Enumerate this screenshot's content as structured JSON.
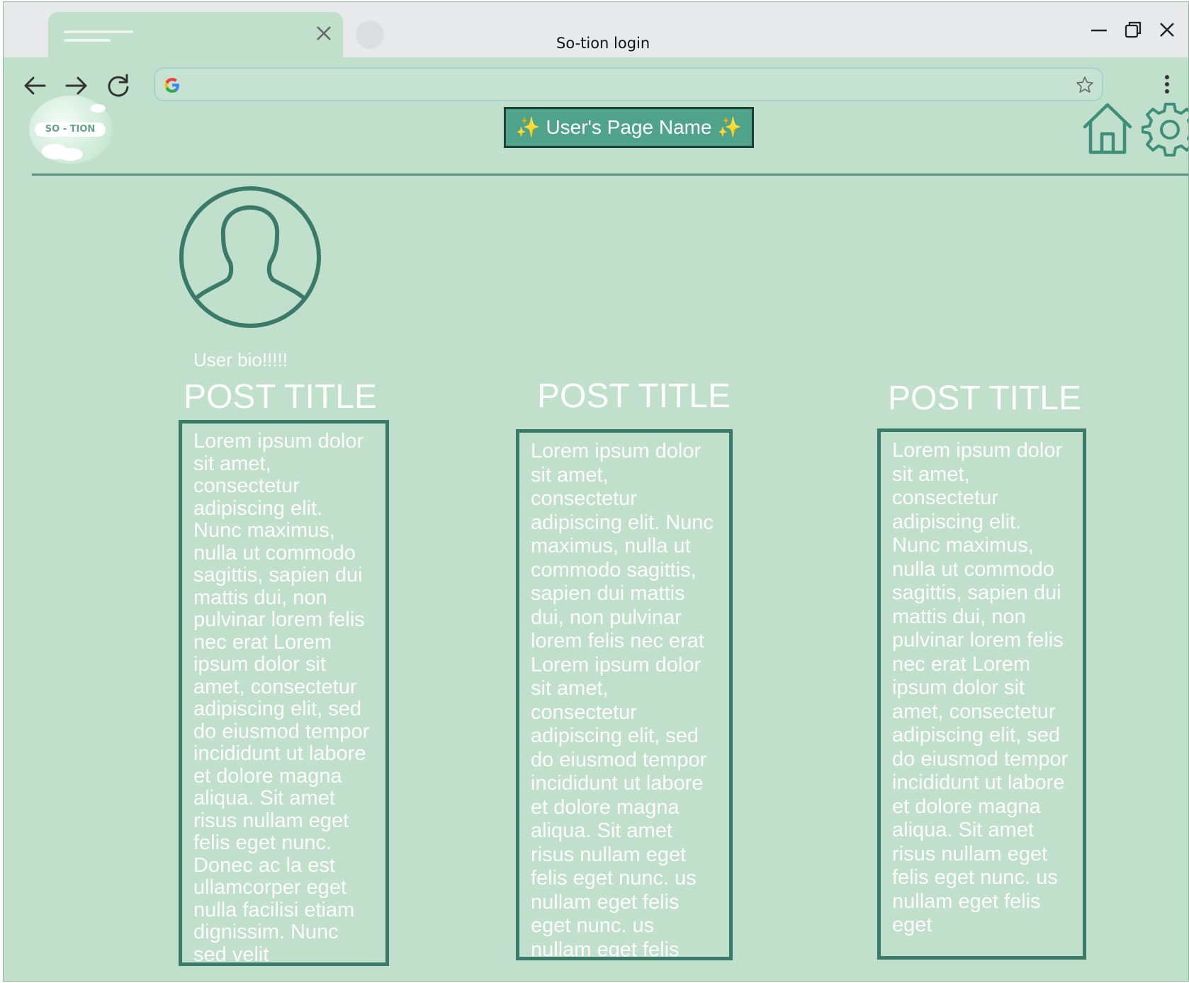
{
  "browser": {
    "window_title": "So-tion login",
    "tab_close_glyph": "×"
  },
  "app": {
    "logo_text": "SO - TION",
    "page_name": "✨ User's Page Name ✨"
  },
  "profile": {
    "bio": "User bio!!!!!"
  },
  "posts": [
    {
      "title": "POST TITLE",
      "body": "Lorem ipsum dolor sit amet, consectetur adipiscing elit. Nunc maximus, nulla ut commodo sagittis, sapien dui mattis dui, non pulvinar lorem felis nec erat Lorem ipsum dolor sit amet, consectetur adipiscing elit, sed do eiusmod tempor incididunt ut labore et dolore magna aliqua. Sit amet risus nullam eget felis eget nunc. Donec ac la est ullamcorper eget nulla facilisi etiam dignissim. Nunc sed velit"
    },
    {
      "title": "POST TITLE",
      "body": "Lorem ipsum dolor sit amet, consectetur adipiscing elit. Nunc maximus, nulla ut commodo sagittis, sapien dui mattis dui, non pulvinar lorem felis nec erat Lorem ipsum dolor sit amet, consectetur adipiscing elit, sed do eiusmod tempor incididunt ut labore et dolore magna aliqua. Sit amet risus nullam eget felis eget nunc. us nullam eget felis eget nunc. us nullam eget felis"
    },
    {
      "title": "POST TITLE",
      "body": "Lorem ipsum dolor sit amet, consectetur adipiscing elit. Nunc maximus, nulla ut commodo sagittis, sapien dui mattis dui, non pulvinar lorem felis nec erat Lorem ipsum dolor sit amet, consectetur adipiscing elit, sed do eiusmod tempor incididunt ut labore et dolore magna aliqua. Sit amet risus nullam eget felis eget nunc. us nullam eget felis eget"
    }
  ],
  "icons": {
    "back": "arrow-left-icon",
    "forward": "arrow-right-icon",
    "reload": "reload-icon",
    "google": "google-icon",
    "bookmark": "star-icon",
    "menu": "kebab-menu-icon",
    "home": "home-icon",
    "settings": "gear-icon",
    "avatar": "user-avatar-icon"
  },
  "colors": {
    "background": "#c0e0cb",
    "accent": "#4fa38b",
    "outline": "#3a7a69",
    "text": "#ffffff"
  }
}
